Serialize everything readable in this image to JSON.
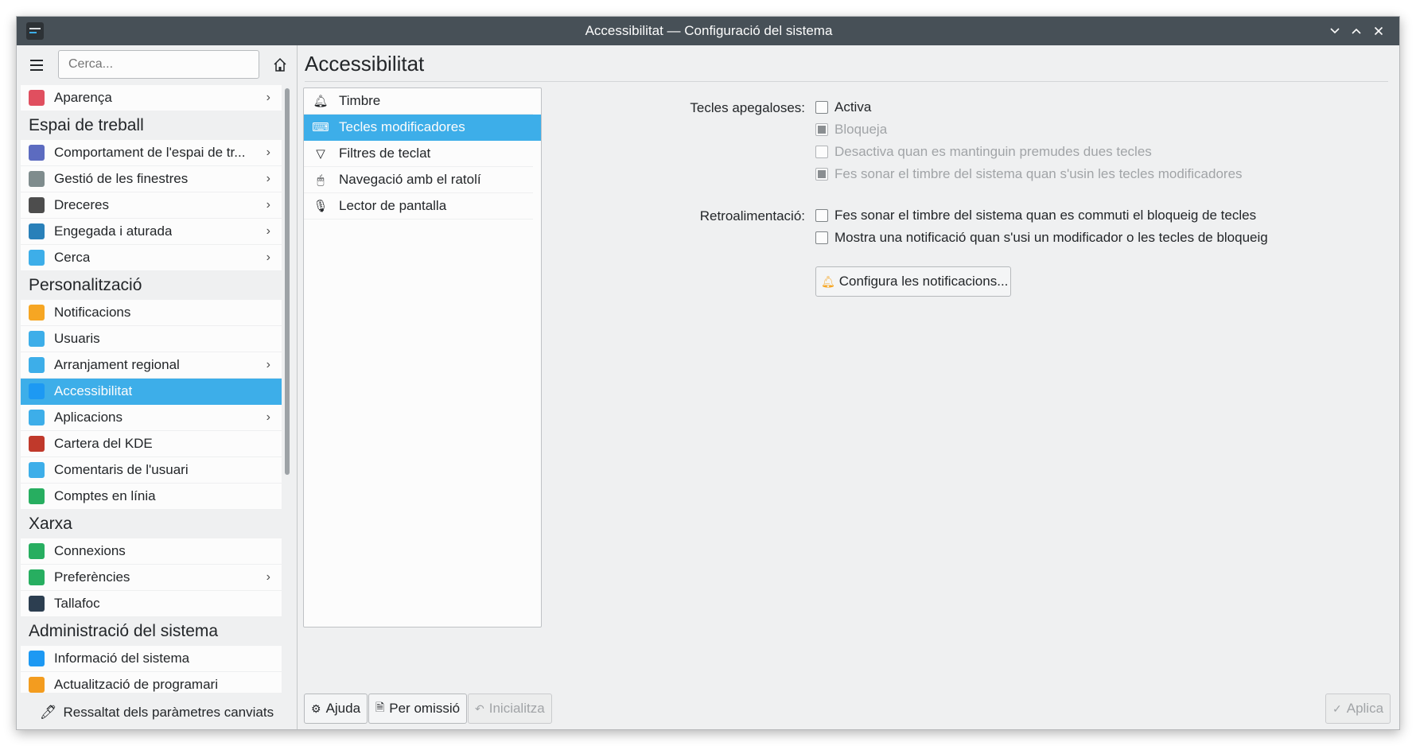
{
  "window": {
    "title": "Accessibilitat — Configuració del sistema",
    "controls": {
      "minimize": "⌵",
      "maximize": "︿",
      "close": "✕"
    }
  },
  "sidebar": {
    "search_placeholder": "Cerca...",
    "items": [
      {
        "type": "item",
        "label": "Aparença",
        "icon": "appearance-icon",
        "color": "#e04f5f",
        "chevron": true
      },
      {
        "type": "category",
        "label": "Espai de treball"
      },
      {
        "type": "item",
        "label": "Comportament de l'espai de tr...",
        "icon": "workspace-icon",
        "color": "#5c6bc0",
        "chevron": true
      },
      {
        "type": "item",
        "label": "Gestió de les finestres",
        "icon": "window-icon",
        "color": "#7f8c8d",
        "chevron": true
      },
      {
        "type": "item",
        "label": "Dreceres",
        "icon": "keyboard-icon",
        "color": "#4d4d4d",
        "chevron": true
      },
      {
        "type": "item",
        "label": "Engegada i aturada",
        "icon": "monitor-icon",
        "color": "#2980b9",
        "chevron": true
      },
      {
        "type": "item",
        "label": "Cerca",
        "icon": "search-icon",
        "color": "#3daee9",
        "chevron": true
      },
      {
        "type": "category",
        "label": "Personalització"
      },
      {
        "type": "item",
        "label": "Notificacions",
        "icon": "bell-icon",
        "color": "#f6a623",
        "chevron": false
      },
      {
        "type": "item",
        "label": "Usuaris",
        "icon": "users-icon",
        "color": "#3daee9",
        "chevron": false
      },
      {
        "type": "item",
        "label": "Arranjament regional",
        "icon": "regional-icon",
        "color": "#3daee9",
        "chevron": true
      },
      {
        "type": "item",
        "label": "Accessibilitat",
        "icon": "accessibility-icon",
        "color": "#1d99f3",
        "chevron": false,
        "selected": true
      },
      {
        "type": "item",
        "label": "Aplicacions",
        "icon": "applications-icon",
        "color": "#3daee9",
        "chevron": true
      },
      {
        "type": "item",
        "label": "Cartera del KDE",
        "icon": "wallet-icon",
        "color": "#c0392b",
        "chevron": false
      },
      {
        "type": "item",
        "label": "Comentaris de l'usuari",
        "icon": "feedback-icon",
        "color": "#3daee9",
        "chevron": false
      },
      {
        "type": "item",
        "label": "Comptes en línia",
        "icon": "globe-icon",
        "color": "#27ae60",
        "chevron": false
      },
      {
        "type": "category",
        "label": "Xarxa"
      },
      {
        "type": "item",
        "label": "Connexions",
        "icon": "globe-icon",
        "color": "#27ae60",
        "chevron": false
      },
      {
        "type": "item",
        "label": "Preferències",
        "icon": "globe-icon",
        "color": "#27ae60",
        "chevron": true
      },
      {
        "type": "item",
        "label": "Tallafoc",
        "icon": "firewall-icon",
        "color": "#2c3e50",
        "chevron": false
      },
      {
        "type": "category",
        "label": "Administració del sistema"
      },
      {
        "type": "item",
        "label": "Informació del sistema",
        "icon": "info-icon",
        "color": "#1d99f3",
        "chevron": false
      },
      {
        "type": "item",
        "label": "Actualització de programari",
        "icon": "update-icon",
        "color": "#f39c1f",
        "chevron": false
      }
    ],
    "bottom_label": "Ressaltat dels paràmetres canviats"
  },
  "main": {
    "title": "Accessibilitat",
    "subpages": [
      {
        "label": "Timbre",
        "icon": "bell-outline-icon",
        "glyph": "🔔︎"
      },
      {
        "label": "Tecles modificadores",
        "icon": "keyboard-icon",
        "glyph": "⌨",
        "selected": true
      },
      {
        "label": "Filtres de teclat",
        "icon": "filter-icon",
        "glyph": "▽"
      },
      {
        "label": "Navegació amb el ratolí",
        "icon": "mouse-icon",
        "glyph": "🖱︎"
      },
      {
        "label": "Lector de pantalla",
        "icon": "microphone-icon",
        "glyph": "🎙︎"
      }
    ],
    "sticky_keys": {
      "label": "Tecles apegaloses:",
      "options": [
        {
          "label": "Activa",
          "state": "unchecked",
          "enabled": true
        },
        {
          "label": "Bloqueja",
          "state": "partial",
          "enabled": false
        },
        {
          "label": "Desactiva quan es mantinguin premudes dues tecles",
          "state": "unchecked",
          "enabled": false
        },
        {
          "label": "Fes sonar el timbre del sistema quan s'usin les tecles modificadores",
          "state": "partial",
          "enabled": false
        }
      ]
    },
    "feedback": {
      "label": "Retroalimentació:",
      "options": [
        {
          "label": "Fes sonar el timbre del sistema quan es commuti el bloqueig de tecles",
          "state": "unchecked",
          "enabled": true
        },
        {
          "label": "Mostra una notificació quan s'usi un modificador o les tecles de bloqueig",
          "state": "unchecked",
          "enabled": true
        }
      ],
      "configure_button": "Configura les notificacions..."
    }
  },
  "footer": {
    "help": "Ajuda",
    "defaults": "Per omissió",
    "reset": "Inicialitza",
    "apply": "Aplica"
  }
}
